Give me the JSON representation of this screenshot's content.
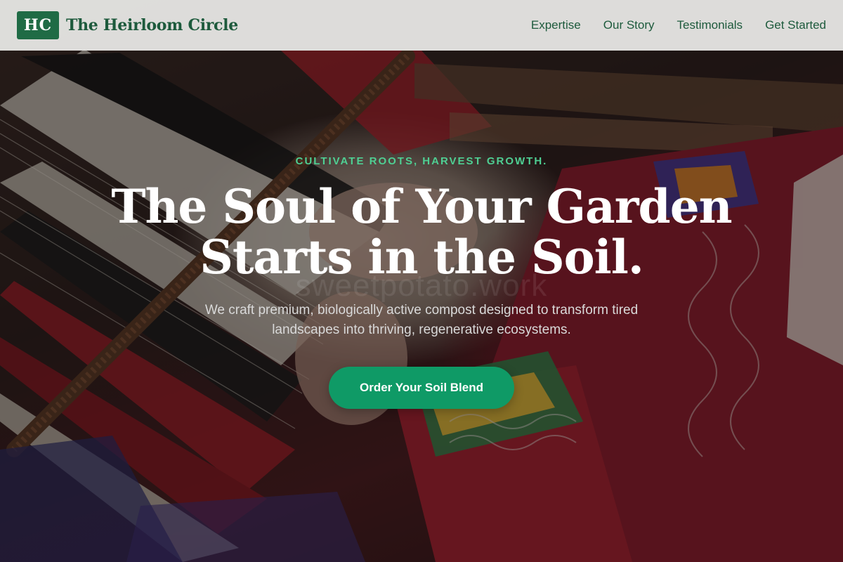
{
  "brand": {
    "mark": "HC",
    "name": "The Heirloom Circle"
  },
  "nav": {
    "links": [
      {
        "label": "Expertise"
      },
      {
        "label": "Our Story"
      },
      {
        "label": "Testimonials"
      },
      {
        "label": "Get Started"
      }
    ]
  },
  "hero": {
    "eyebrow": "CULTIVATE ROOTS, HARVEST GROWTH.",
    "headline_line1": "The Soul of Your Garden",
    "headline_line2": "Starts in the Soil.",
    "watermark": "sweetpotato.work",
    "subtext": "We craft premium, biologically active compost designed to transform tired landscapes into thriving, regenerative ecosystems.",
    "cta_label": "Order Your Soil Blend"
  },
  "colors": {
    "brand_green": "#1f6b45",
    "brand_text": "#1d5a3c",
    "accent_green": "#4fcf93",
    "cta_bg": "#0f9a66",
    "nav_bg": "#ececea"
  }
}
